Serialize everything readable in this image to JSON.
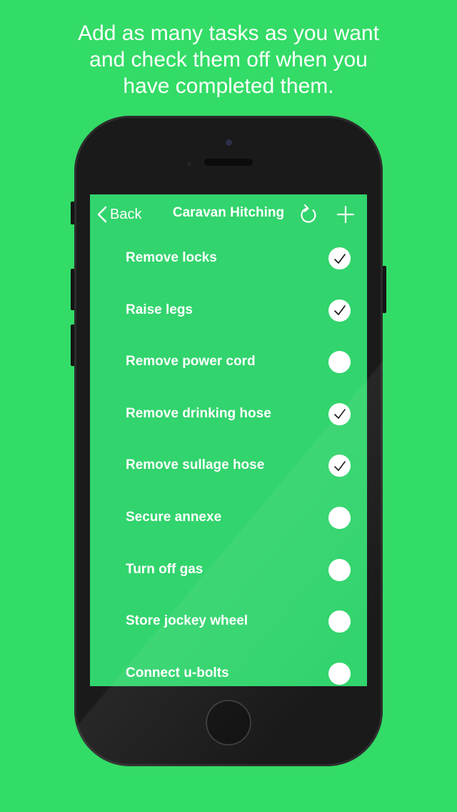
{
  "promo": {
    "line1": "Add as many tasks as you want",
    "line2": "and check them off when you",
    "line3": "have completed them."
  },
  "colors": {
    "background": "#33dc66",
    "screen": "#32d46d",
    "phone_body": "#1a1a1a",
    "text": "#ffffff"
  },
  "nav": {
    "back_label": "Back",
    "title": "Caravan Hitching",
    "back_icon": "chevron-left-icon",
    "refresh_icon": "refresh-icon",
    "add_icon": "plus-icon"
  },
  "tasks": [
    {
      "label": "Remove locks",
      "checked": true
    },
    {
      "label": "Raise legs",
      "checked": true
    },
    {
      "label": "Remove power cord",
      "checked": false
    },
    {
      "label": "Remove drinking hose",
      "checked": true
    },
    {
      "label": "Remove sullage hose",
      "checked": true
    },
    {
      "label": "Secure annexe",
      "checked": false
    },
    {
      "label": "Turn off gas",
      "checked": false
    },
    {
      "label": "Store jockey wheel",
      "checked": false
    },
    {
      "label": "Connect u-bolts",
      "checked": false
    }
  ]
}
